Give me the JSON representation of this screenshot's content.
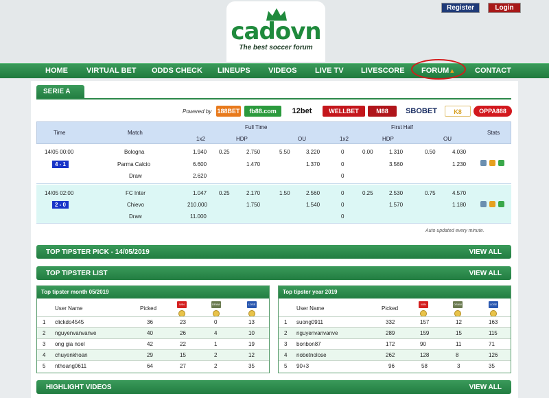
{
  "header": {
    "logo_text": "cadovn",
    "tagline": "The best soccer forum",
    "register_label": "Register",
    "login_label": "Login"
  },
  "nav": {
    "items": [
      "HOME",
      "VIRTUAL BET",
      "ODDS CHECK",
      "LINEUPS",
      "VIDEOS",
      "LIVE TV",
      "LIVESCORE",
      "FORUM",
      "CONTACT"
    ]
  },
  "league": {
    "tab_label": "SERIE A",
    "powered_by": "Powered by",
    "bookmakers": [
      "188BET",
      "fb88.com",
      "12bet",
      "WELLBET",
      "M88",
      "SBOBET",
      "K8",
      "OPPA888"
    ]
  },
  "odds_table": {
    "headers": {
      "time": "Time",
      "match": "Match",
      "full_time": "Full Time",
      "first_half": "First Half",
      "stats": "Stats",
      "one_x_two": "1x2",
      "hdp": "HDP",
      "ou": "OU"
    },
    "matches": [
      {
        "time": "14/05 00:00",
        "score": "4 - 1",
        "teams": [
          "Bologna",
          "Parma Calcio",
          "Draw"
        ],
        "ft_1x2": [
          "1.940",
          "6.600",
          "2.620"
        ],
        "ft_hdp_line": "0.25",
        "ft_hdp": [
          "2.750",
          "1.470"
        ],
        "ft_ou_line": "5.50",
        "ft_ou": [
          "3.220",
          "1.370"
        ],
        "fh_1x2": [
          "0",
          "0",
          "0"
        ],
        "fh_hdp_line": "0.00",
        "fh_hdp": [
          "1.310",
          "3.560"
        ],
        "fh_ou_line": "0.50",
        "fh_ou": [
          "4.030",
          "1.230"
        ]
      },
      {
        "time": "14/05 02:00",
        "score": "2 - 0",
        "teams": [
          "FC Inter",
          "Chievo",
          "Draw"
        ],
        "ft_1x2": [
          "1.047",
          "210.000",
          "11.000"
        ],
        "ft_hdp_line": "0.25",
        "ft_hdp": [
          "2.170",
          "1.750"
        ],
        "ft_ou_line": "1.50",
        "ft_ou": [
          "2.560",
          "1.540"
        ],
        "fh_1x2": [
          "0",
          "0",
          "0"
        ],
        "fh_hdp_line": "0.25",
        "fh_hdp": [
          "2.530",
          "1.570"
        ],
        "fh_ou_line": "0.75",
        "fh_ou": [
          "4.570",
          "1.180"
        ]
      }
    ],
    "auto_updated": "Auto updated every minute."
  },
  "sections": {
    "top_pick": "TOP TIPSTER PICK - 14/05/2019",
    "tipster_list": "TOP TIPSTER LIST",
    "highlight_videos": "HIGHLIGHT VIDEOS",
    "view_all": "VIEW ALL"
  },
  "tipster_month": {
    "title": "Top tipster month 05/2019",
    "col_user": "User Name",
    "col_picked": "Picked",
    "badges": [
      "WIN",
      "DRAW",
      "LOSE"
    ],
    "rows": [
      [
        "1",
        "clickdo4545",
        "36",
        "23",
        "0",
        "13"
      ],
      [
        "2",
        "nguyenvanvanve",
        "40",
        "26",
        "4",
        "10"
      ],
      [
        "3",
        "ong gia noel",
        "42",
        "22",
        "1",
        "19"
      ],
      [
        "4",
        "chuyenkhoan",
        "29",
        "15",
        "2",
        "12"
      ],
      [
        "5",
        "nthoang0611",
        "64",
        "27",
        "2",
        "35"
      ]
    ]
  },
  "tipster_year": {
    "title": "Top tipster year 2019",
    "col_user": "User Name",
    "col_picked": "Picked",
    "badges": [
      "WIN",
      "DRAW",
      "LOSE"
    ],
    "rows": [
      [
        "1",
        "suong0911",
        "332",
        "157",
        "12",
        "163"
      ],
      [
        "2",
        "nguyenvanvanve",
        "289",
        "159",
        "15",
        "115"
      ],
      [
        "3",
        "bonbon87",
        "172",
        "90",
        "11",
        "71"
      ],
      [
        "4",
        "nobetnolose",
        "262",
        "128",
        "8",
        "126"
      ],
      [
        "5",
        "90+3",
        "96",
        "58",
        "3",
        "35"
      ]
    ]
  },
  "colors": {
    "green": "#2a8748",
    "score_blue": "#1834c8",
    "forum_ring": "#d31a1a"
  }
}
